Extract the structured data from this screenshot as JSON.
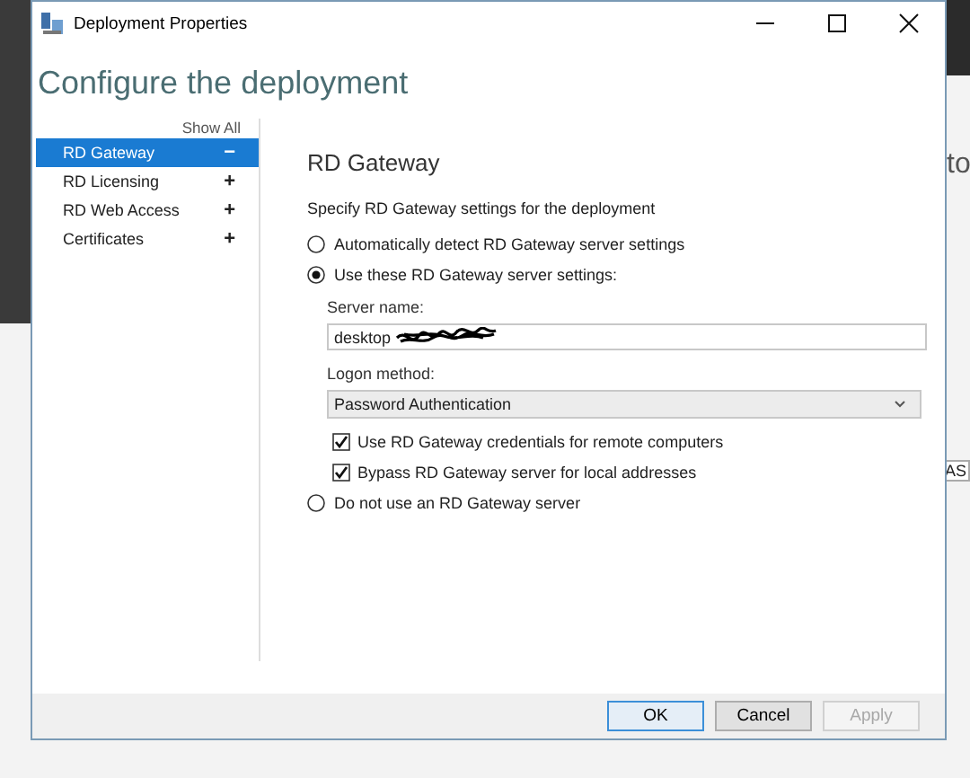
{
  "window": {
    "title": "Deployment Properties"
  },
  "header": "Configure the deployment",
  "sidebar": {
    "show_all": "Show All",
    "items": [
      {
        "label": "RD Gateway",
        "toggle": "−",
        "selected": true
      },
      {
        "label": "RD Licensing",
        "toggle": "+",
        "selected": false
      },
      {
        "label": "RD Web Access",
        "toggle": "+",
        "selected": false
      },
      {
        "label": "Certificates",
        "toggle": "+",
        "selected": false
      }
    ]
  },
  "panel": {
    "title": "RD Gateway",
    "intro": "Specify RD Gateway settings for the deployment",
    "options": [
      {
        "kind": "radio",
        "label": "Automatically detect RD Gateway server settings",
        "selected": false
      },
      {
        "kind": "radio",
        "label": "Use these RD Gateway server settings:",
        "selected": true,
        "children": [
          {
            "kind": "label",
            "label": "Server name:"
          },
          {
            "kind": "field",
            "value": "desktop"
          },
          {
            "kind": "label",
            "label": "Logon method:"
          },
          {
            "kind": "dropdown",
            "value": "Password Authentication"
          },
          {
            "kind": "checkbox",
            "label": "Use RD Gateway credentials for remote computers",
            "checked": true
          },
          {
            "kind": "checkbox",
            "label": "Bypass RD Gateway server for local addresses",
            "checked": true
          }
        ]
      },
      {
        "kind": "radio",
        "label": "Do not use an RD Gateway server",
        "selected": false
      }
    ]
  },
  "buttons": [
    {
      "label": "OK",
      "default": true,
      "disabled": false
    },
    {
      "label": "Cancel",
      "default": false,
      "disabled": false
    },
    {
      "label": "Apply",
      "default": false,
      "disabled": true
    }
  ],
  "background": {
    "texts": [
      "to",
      "AS"
    ]
  }
}
